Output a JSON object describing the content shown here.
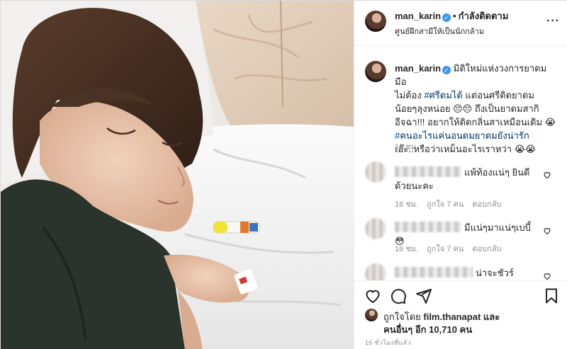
{
  "header": {
    "username": "man_karin",
    "verified_mark": "✓",
    "separator": "•",
    "follow_status": "กำลังติดตาม",
    "location": "ศูนย์ฝึกสามีให้เป็นนักกล้าม",
    "more_icon": "more-horizontal-icon",
    "more_glyph": "···"
  },
  "caption": {
    "username": "man_karin",
    "line1": " มิติใหม่แห่งวงการยาดม มือ",
    "line2": "ไม่ต้อง ",
    "hashtag1": "#ศรีดมได้",
    "line2b": " แต่อนศรีติดยาดม",
    "line3": "น้อยๆลุงหน่อย 😔😔 ถึงเป็นยาดมสากิ",
    "line4": "อีจฉา!!! อยากให้ติดกลิ่นสาเหมือนเดิม 😭",
    "hashtag2": "#คนอะไรแค่นอนดมยาดมยังน่ารัก",
    "line6": "เอ๊ะ..หรือว่าเหม็นอะไรเราหว่า 😭😭",
    "time": "16 ชม."
  },
  "comments": [
    {
      "text": "แพ้ท้องแน่ๆ ยินดี",
      "text2": "ด้วยนะคะ",
      "time": "16 ชม.",
      "likes": "ถูกใจ 7 คน",
      "reply": "ตอบกลับ"
    },
    {
      "text": "มีแน่ๆมาแน่ๆเบบี้😳",
      "time": "16 ชม.",
      "likes": "ถูกใจ 7 คน",
      "reply": "ตอบกลับ"
    },
    {
      "text": "น่าจะชัวร์"
    }
  ],
  "actions": {
    "like_icon": "heart-icon",
    "comment_icon": "comment-icon",
    "share_icon": "paper-plane-icon",
    "save_icon": "bookmark-icon"
  },
  "likes": {
    "prefix": "ถูกใจโดย ",
    "user": "film.thanapat",
    "and": " และ",
    "others_prefix": "คนอื่นๆ ",
    "others_count": "อีก 10,710 คน"
  },
  "post_date": "16 ชั่วโมงที่แล้ว",
  "colors": {
    "accent_blue": "#3897f0",
    "hashtag": "#00376b",
    "meta_gray": "#8e8e8e",
    "border": "#dbdbdb"
  }
}
